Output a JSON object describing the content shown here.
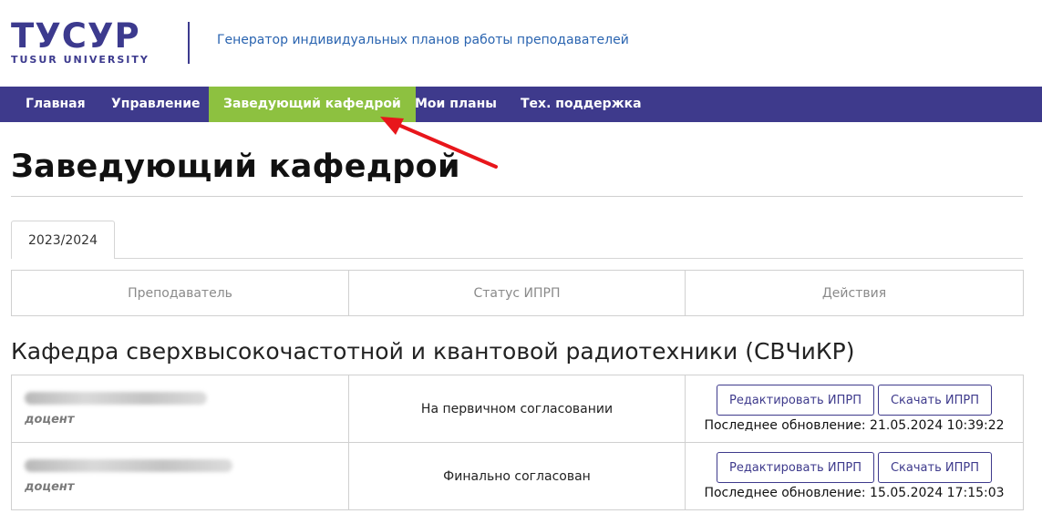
{
  "header": {
    "logo_main": "ТУСУР",
    "logo_sub": "TUSUR UNIVERSITY",
    "site_title": "Генератор индивидуальных планов работы преподавателей"
  },
  "nav": {
    "items": [
      {
        "label": "Главная"
      },
      {
        "label": "Управление"
      },
      {
        "label": "Заведующий кафедрой",
        "active": true
      },
      {
        "label": "Мои планы"
      },
      {
        "label": "Тех. поддержка"
      }
    ]
  },
  "colors": {
    "brand": "#3e3a8c",
    "active_nav": "#8dc140",
    "arrow": "#e8161b",
    "link": "#2a64b0"
  },
  "page": {
    "title": "Заведующий кафедрой",
    "tab": "2023/2024"
  },
  "table_header": {
    "teacher": "Преподаватель",
    "status": "Статус ИПРП",
    "actions": "Действия"
  },
  "department": {
    "title": "Кафедра сверхвысокочастотной и квантовой радиотехники (СВЧиКР)",
    "rows": [
      {
        "position": "доцент",
        "status": "На первичном согласовании",
        "edit_label": "Редактировать ИПРП",
        "download_label": "Скачать ИПРП",
        "updated": "Последнее обновление: 21.05.2024 10:39:22"
      },
      {
        "position": "доцент",
        "status": "Финально согласован",
        "edit_label": "Редактировать ИПРП",
        "download_label": "Скачать ИПРП",
        "updated": "Последнее обновление: 15.05.2024 17:15:03"
      }
    ]
  }
}
